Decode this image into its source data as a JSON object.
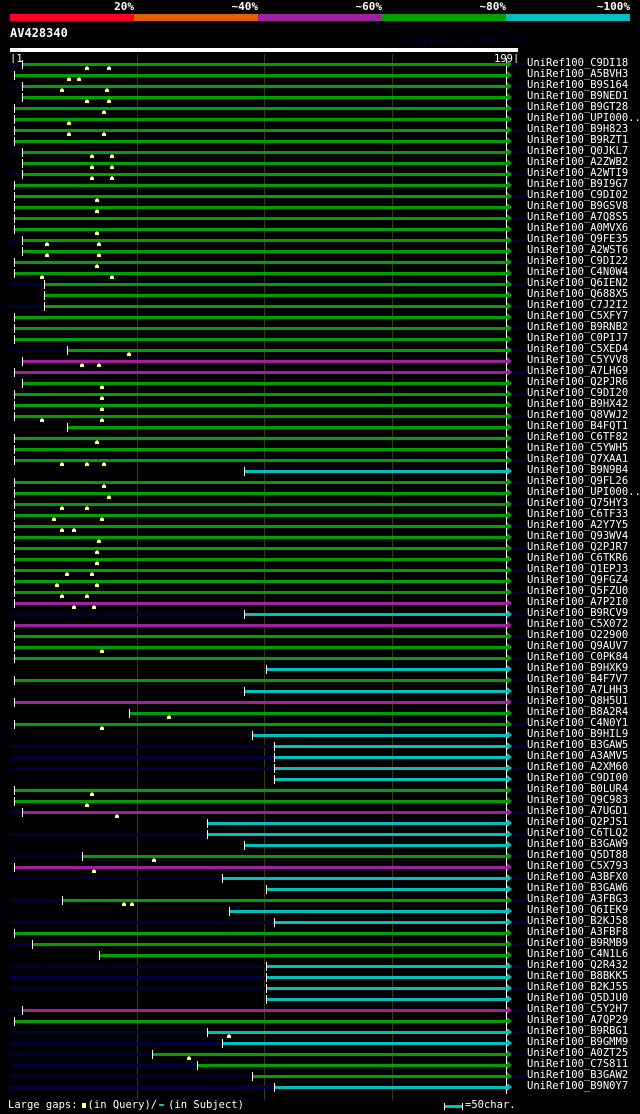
{
  "header": {
    "percent_labels": [
      "20%",
      "~40%",
      "~60%",
      "~80%",
      "~100%"
    ],
    "scale_colors": [
      "#ff0020",
      "#e06000",
      "#a020a0",
      "#00a000",
      "#00c0c0"
    ],
    "query_id": "AV428340",
    "credit": "AlignView.pm Beta rel.7",
    "start_label": "|1",
    "end_label": "199|"
  },
  "query_length": 199,
  "colors": {
    "g": "#00a000",
    "m": "#a020a0",
    "c": "#00c0c0",
    "lead": "#000040",
    "gap": "#ffff80"
  },
  "rows": [
    {
      "n": "UniRef100_C9DI18",
      "c": "g",
      "s": 5,
      "l": 1,
      "g": [
        31,
        40
      ]
    },
    {
      "n": "UniRef100_A5BVH3",
      "c": "g",
      "s": 2,
      "l": 0,
      "g": [
        24,
        28
      ]
    },
    {
      "n": "UniRef100_B9S164",
      "c": "g",
      "s": 5,
      "l": 1,
      "g": [
        21,
        39
      ]
    },
    {
      "n": "UniRef100_B9NED1",
      "c": "g",
      "s": 5,
      "l": 0,
      "g": [
        31,
        40
      ]
    },
    {
      "n": "UniRef100_B9GT28",
      "c": "g",
      "s": 2,
      "l": 1,
      "g": [
        38
      ]
    },
    {
      "n": "UniRef100_UPI000..",
      "c": "g",
      "s": 2,
      "l": 0,
      "g": [
        24
      ]
    },
    {
      "n": "UniRef100_B9H823",
      "c": "g",
      "s": 2,
      "l": 1,
      "g": [
        24,
        38
      ]
    },
    {
      "n": "UniRef100_B9RZT1",
      "c": "g",
      "s": 2,
      "l": 0,
      "g": []
    },
    {
      "n": "UniRef100_Q0JKL7",
      "c": "g",
      "s": 5,
      "l": 1,
      "g": [
        33,
        41
      ]
    },
    {
      "n": "UniRef100_A2ZWB2",
      "c": "g",
      "s": 5,
      "l": 0,
      "g": [
        33,
        41
      ]
    },
    {
      "n": "UniRef100_A2WTI9",
      "c": "g",
      "s": 5,
      "l": 1,
      "g": [
        33,
        41
      ]
    },
    {
      "n": "UniRef100_B9I9G7",
      "c": "g",
      "s": 2,
      "l": 0,
      "g": []
    },
    {
      "n": "UniRef100_C9DI02",
      "c": "g",
      "s": 2,
      "l": 1,
      "g": [
        35
      ]
    },
    {
      "n": "UniRef100_B9GSV8",
      "c": "g",
      "s": 2,
      "l": 0,
      "g": [
        35
      ]
    },
    {
      "n": "UniRef100_A7Q8S5",
      "c": "g",
      "s": 2,
      "l": 1,
      "g": []
    },
    {
      "n": "UniRef100_A0MVX6",
      "c": "g",
      "s": 2,
      "l": 0,
      "g": [
        35
      ]
    },
    {
      "n": "UniRef100_Q9FE35",
      "c": "g",
      "s": 5,
      "l": 1,
      "g": [
        15,
        36
      ]
    },
    {
      "n": "UniRef100_A2WST6",
      "c": "g",
      "s": 5,
      "l": 0,
      "g": [
        15,
        36
      ]
    },
    {
      "n": "UniRef100_C9DI22",
      "c": "g",
      "s": 2,
      "l": 1,
      "g": [
        35
      ]
    },
    {
      "n": "UniRef100_C4N0W4",
      "c": "g",
      "s": 2,
      "l": 0,
      "g": [
        13,
        41
      ]
    },
    {
      "n": "UniRef100_Q6IEN2",
      "c": "g",
      "s": 14,
      "l": 1,
      "g": []
    },
    {
      "n": "UniRef100_Q688X5",
      "c": "g",
      "s": 14,
      "l": 0,
      "g": []
    },
    {
      "n": "UniRef100_C7J2I2",
      "c": "g",
      "s": 14,
      "l": 1,
      "g": []
    },
    {
      "n": "UniRef100_C5XFY7",
      "c": "g",
      "s": 2,
      "l": 0,
      "g": []
    },
    {
      "n": "UniRef100_B9RNB2",
      "c": "g",
      "s": 2,
      "l": 1,
      "g": []
    },
    {
      "n": "UniRef100_C0PIJ7",
      "c": "g",
      "s": 2,
      "l": 0,
      "g": []
    },
    {
      "n": "UniRef100_C5XED4",
      "c": "g",
      "s": 23,
      "l": 1,
      "g": [
        48
      ]
    },
    {
      "n": "UniRef100_C5YVV8",
      "c": "m",
      "s": 5,
      "l": 0,
      "g": [
        29,
        36
      ]
    },
    {
      "n": "UniRef100_A7LHG9",
      "c": "m",
      "s": 2,
      "l": 1,
      "g": []
    },
    {
      "n": "UniRef100_Q2PJR6",
      "c": "g",
      "s": 5,
      "l": 0,
      "g": [
        37
      ]
    },
    {
      "n": "UniRef100_C9DI20",
      "c": "g",
      "s": 2,
      "l": 1,
      "g": [
        37
      ]
    },
    {
      "n": "UniRef100_B9HX42",
      "c": "g",
      "s": 2,
      "l": 0,
      "g": [
        37
      ]
    },
    {
      "n": "UniRef100_Q8VWJ2",
      "c": "g",
      "s": 2,
      "l": 1,
      "g": [
        13,
        37
      ]
    },
    {
      "n": "UniRef100_B4FQT1",
      "c": "g",
      "s": 23,
      "l": 0,
      "g": []
    },
    {
      "n": "UniRef100_C6TF82",
      "c": "g",
      "s": 2,
      "l": 1,
      "g": [
        35
      ]
    },
    {
      "n": "UniRef100_C5YWH5",
      "c": "g",
      "s": 2,
      "l": 0,
      "g": []
    },
    {
      "n": "UniRef100_Q7XAA1",
      "c": "g",
      "s": 2,
      "l": 1,
      "g": [
        21,
        31,
        38
      ]
    },
    {
      "n": "UniRef100_B9N9B4",
      "c": "c",
      "s": 94,
      "l": 0,
      "g": []
    },
    {
      "n": "UniRef100_Q9FL26",
      "c": "g",
      "s": 2,
      "l": 1,
      "g": [
        38
      ]
    },
    {
      "n": "UniRef100_UPI000..",
      "c": "g",
      "s": 2,
      "l": 0,
      "g": [
        40
      ]
    },
    {
      "n": "UniRef100_Q75HY3",
      "c": "g",
      "s": 2,
      "l": 1,
      "g": [
        21,
        31
      ]
    },
    {
      "n": "UniRef100_C6TF33",
      "c": "g",
      "s": 2,
      "l": 0,
      "g": [
        18,
        37
      ]
    },
    {
      "n": "UniRef100_A2Y7Y5",
      "c": "g",
      "s": 2,
      "l": 1,
      "g": [
        21,
        26
      ]
    },
    {
      "n": "UniRef100_Q93WV4",
      "c": "g",
      "s": 2,
      "l": 0,
      "g": [
        36
      ]
    },
    {
      "n": "UniRef100_Q2PJR7",
      "c": "g",
      "s": 2,
      "l": 1,
      "g": [
        35
      ]
    },
    {
      "n": "UniRef100_C6TKR6",
      "c": "g",
      "s": 2,
      "l": 0,
      "g": [
        35
      ]
    },
    {
      "n": "UniRef100_Q1EPJ3",
      "c": "g",
      "s": 2,
      "l": 1,
      "g": [
        23,
        33
      ]
    },
    {
      "n": "UniRef100_Q9FGZ4",
      "c": "g",
      "s": 2,
      "l": 0,
      "g": [
        19,
        35
      ]
    },
    {
      "n": "UniRef100_Q5FZU0",
      "c": "g",
      "s": 2,
      "l": 1,
      "g": [
        21,
        31
      ]
    },
    {
      "n": "UniRef100_A7P2I0",
      "c": "m",
      "s": 2,
      "l": 0,
      "g": [
        26,
        34
      ]
    },
    {
      "n": "UniRef100_B9RCV9",
      "c": "c",
      "s": 94,
      "l": 1,
      "g": []
    },
    {
      "n": "UniRef100_C5X072",
      "c": "m",
      "s": 2,
      "l": 0,
      "g": []
    },
    {
      "n": "UniRef100_O22900",
      "c": "g",
      "s": 2,
      "l": 1,
      "g": []
    },
    {
      "n": "UniRef100_Q9AUV7",
      "c": "g",
      "s": 2,
      "l": 0,
      "g": [
        37
      ]
    },
    {
      "n": "UniRef100_C0PK84",
      "c": "g",
      "s": 2,
      "l": 1,
      "g": []
    },
    {
      "n": "UniRef100_B9HXK9",
      "c": "c",
      "s": 103,
      "l": 0,
      "g": []
    },
    {
      "n": "UniRef100_B4F7V7",
      "c": "g",
      "s": 2,
      "l": 1,
      "g": []
    },
    {
      "n": "UniRef100_A7LHH3",
      "c": "c",
      "s": 94,
      "l": 0,
      "g": []
    },
    {
      "n": "UniRef100_Q8H5U1",
      "c": "m",
      "s": 2,
      "l": 1,
      "g": []
    },
    {
      "n": "UniRef100_B8A2R4",
      "c": "g",
      "s": 48,
      "l": 0,
      "g": [
        64
      ]
    },
    {
      "n": "UniRef100_C4N0Y1",
      "c": "g",
      "s": 2,
      "l": 1,
      "g": [
        37
      ]
    },
    {
      "n": "UniRef100_B9HIL9",
      "c": "c",
      "s": 97,
      "l": 0,
      "g": []
    },
    {
      "n": "UniRef100_B3GAW5",
      "c": "c",
      "s": 106,
      "l": 1,
      "g": []
    },
    {
      "n": "UniRef100_A3AMV5",
      "c": "c",
      "s": 106,
      "l": 1,
      "g": []
    },
    {
      "n": "UniRef100_A2XM60",
      "c": "c",
      "s": 106,
      "l": 1,
      "g": []
    },
    {
      "n": "UniRef100_C9DI00",
      "c": "c",
      "s": 106,
      "l": 0,
      "g": []
    },
    {
      "n": "UniRef100_B0LUR4",
      "c": "g",
      "s": 2,
      "l": 1,
      "g": [
        33
      ]
    },
    {
      "n": "UniRef100_Q9C983",
      "c": "g",
      "s": 2,
      "l": 0,
      "g": [
        31
      ]
    },
    {
      "n": "UniRef100_A7UGD1",
      "c": "m",
      "s": 5,
      "l": 1,
      "g": [
        43
      ]
    },
    {
      "n": "UniRef100_Q2PJS1",
      "c": "c",
      "s": 79,
      "l": 0,
      "g": []
    },
    {
      "n": "UniRef100_C6TLQ2",
      "c": "c",
      "s": 79,
      "l": 1,
      "g": []
    },
    {
      "n": "UniRef100_B3GAW9",
      "c": "c",
      "s": 94,
      "l": 0,
      "g": []
    },
    {
      "n": "UniRef100_Q5DT88",
      "c": "g",
      "s": 29,
      "l": 1,
      "g": [
        58
      ]
    },
    {
      "n": "UniRef100_C5X793",
      "c": "m",
      "s": 2,
      "l": 0,
      "g": [
        34
      ]
    },
    {
      "n": "UniRef100_A3BFX0",
      "c": "c",
      "s": 85,
      "l": 1,
      "g": []
    },
    {
      "n": "UniRef100_B3GAW6",
      "c": "c",
      "s": 103,
      "l": 0,
      "g": []
    },
    {
      "n": "UniRef100_A3FBG3",
      "c": "g",
      "s": 21,
      "l": 1,
      "g": [
        46,
        49
      ]
    },
    {
      "n": "UniRef100_Q6IEK9",
      "c": "c",
      "s": 88,
      "l": 0,
      "g": []
    },
    {
      "n": "UniRef100_B2KJ58",
      "c": "c",
      "s": 106,
      "l": 1,
      "g": []
    },
    {
      "n": "UniRef100_A3FBF8",
      "c": "g",
      "s": 2,
      "l": 0,
      "g": []
    },
    {
      "n": "UniRef100_B9RMB9",
      "c": "g",
      "s": 9,
      "l": 1,
      "g": []
    },
    {
      "n": "UniRef100_C4N1L6",
      "c": "g",
      "s": 36,
      "l": 0,
      "g": []
    },
    {
      "n": "UniRef100_Q2R432",
      "c": "c",
      "s": 103,
      "l": 1,
      "g": []
    },
    {
      "n": "UniRef100_B8BKK5",
      "c": "c",
      "s": 103,
      "l": 1,
      "g": []
    },
    {
      "n": "UniRef100_B2KJ55",
      "c": "c",
      "s": 103,
      "l": 1,
      "g": []
    },
    {
      "n": "UniRef100_Q5DJU0",
      "c": "c",
      "s": 103,
      "l": 0,
      "g": []
    },
    {
      "n": "UniRef100_C5Y2H7",
      "c": "m",
      "s": 5,
      "l": 1,
      "g": []
    },
    {
      "n": "UniRef100_A7QP29",
      "c": "g",
      "s": 2,
      "l": 0,
      "g": []
    },
    {
      "n": "UniRef100_B9RBG1",
      "c": "c",
      "s": 79,
      "l": 1,
      "g": [
        88
      ]
    },
    {
      "n": "UniRef100_B9GMM9",
      "c": "c",
      "s": 85,
      "l": 1,
      "g": []
    },
    {
      "n": "UniRef100_A0ZT25",
      "c": "g",
      "s": 57,
      "l": 1,
      "g": [
        72
      ]
    },
    {
      "n": "UniRef100_C7S811",
      "c": "g",
      "s": 75,
      "l": 1,
      "g": []
    },
    {
      "n": "UniRef100_B3GAW2",
      "c": "g",
      "s": 97,
      "l": 1,
      "g": []
    },
    {
      "n": "UniRef100_B9N0Y7",
      "c": "c",
      "s": 106,
      "l": 1,
      "g": []
    }
  ],
  "footer": {
    "large_gaps_label": "Large gaps:",
    "in_query_label": "(in Query)/",
    "in_subject_label": "(in Subject)",
    "scale_label": "=50char."
  }
}
